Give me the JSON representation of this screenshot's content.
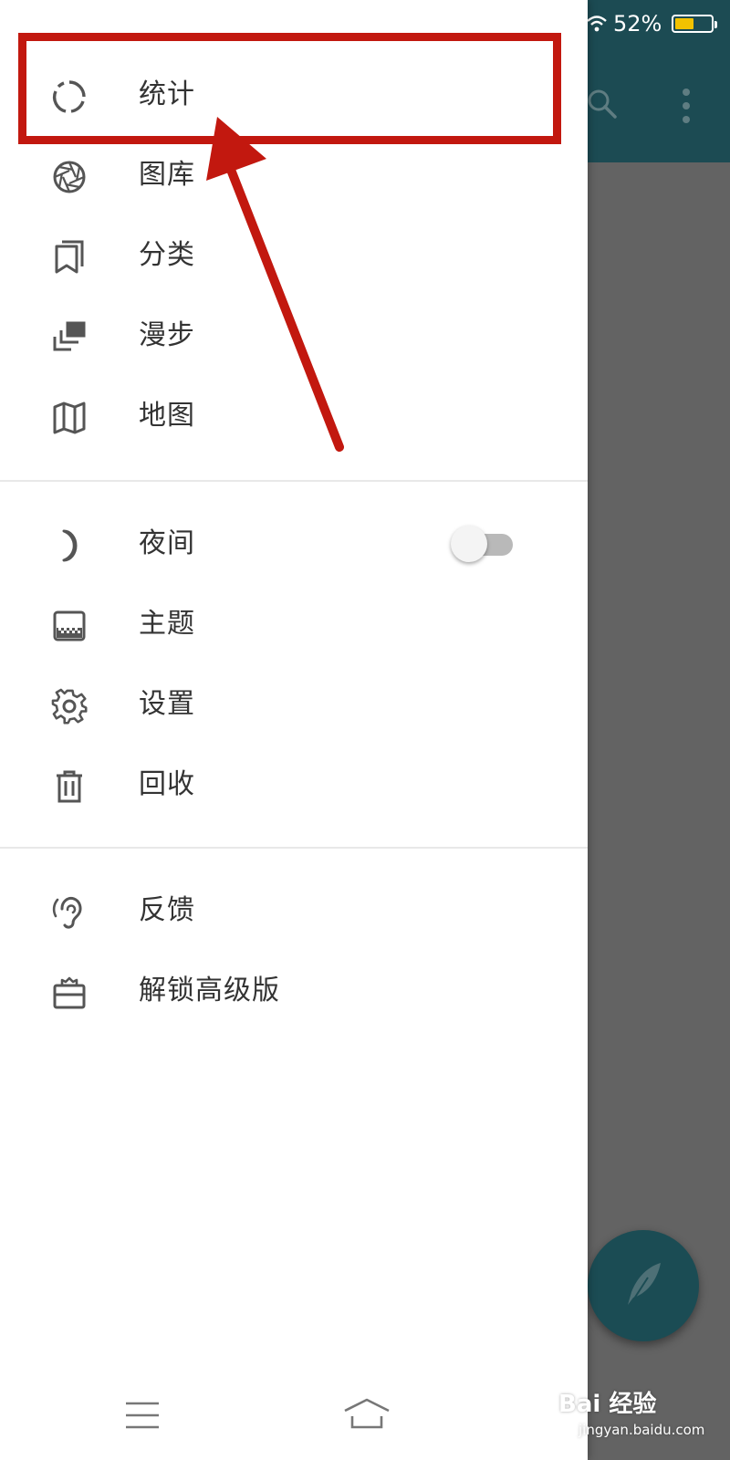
{
  "status_bar": {
    "battery_text": "52%",
    "battery_level": 0.52,
    "battery_color": "#f2c200"
  },
  "toolbar": {
    "color": "#1c4b53",
    "search_icon": "search-icon",
    "more_icon": "more-vert-icon"
  },
  "drawer": {
    "groups": [
      {
        "items": [
          {
            "label": "统计",
            "icon": "statistics-icon"
          },
          {
            "label": "图库",
            "icon": "aperture-icon"
          },
          {
            "label": "分类",
            "icon": "bookmark-icon"
          },
          {
            "label": "漫步",
            "icon": "stack-icon"
          },
          {
            "label": "地图",
            "icon": "map-icon"
          }
        ]
      },
      {
        "items": [
          {
            "label": "夜间",
            "icon": "moon-icon",
            "toggle": false
          },
          {
            "label": "主题",
            "icon": "theme-icon"
          },
          {
            "label": "设置",
            "icon": "gear-icon"
          },
          {
            "label": "回收",
            "icon": "trash-icon"
          }
        ]
      },
      {
        "items": [
          {
            "label": "反馈",
            "icon": "ear-icon"
          },
          {
            "label": "解锁高级版",
            "icon": "gift-icon"
          }
        ]
      }
    ]
  },
  "fab": {
    "icon": "feather-icon",
    "color": "#1b4c54"
  },
  "annotation": {
    "color": "#c2180f"
  },
  "nav_bar": {
    "menu_icon": "menu-icon",
    "home_icon": "home-icon"
  },
  "watermark": {
    "brand": "Bai 经验",
    "domain": "jingyan.baidu.com"
  }
}
